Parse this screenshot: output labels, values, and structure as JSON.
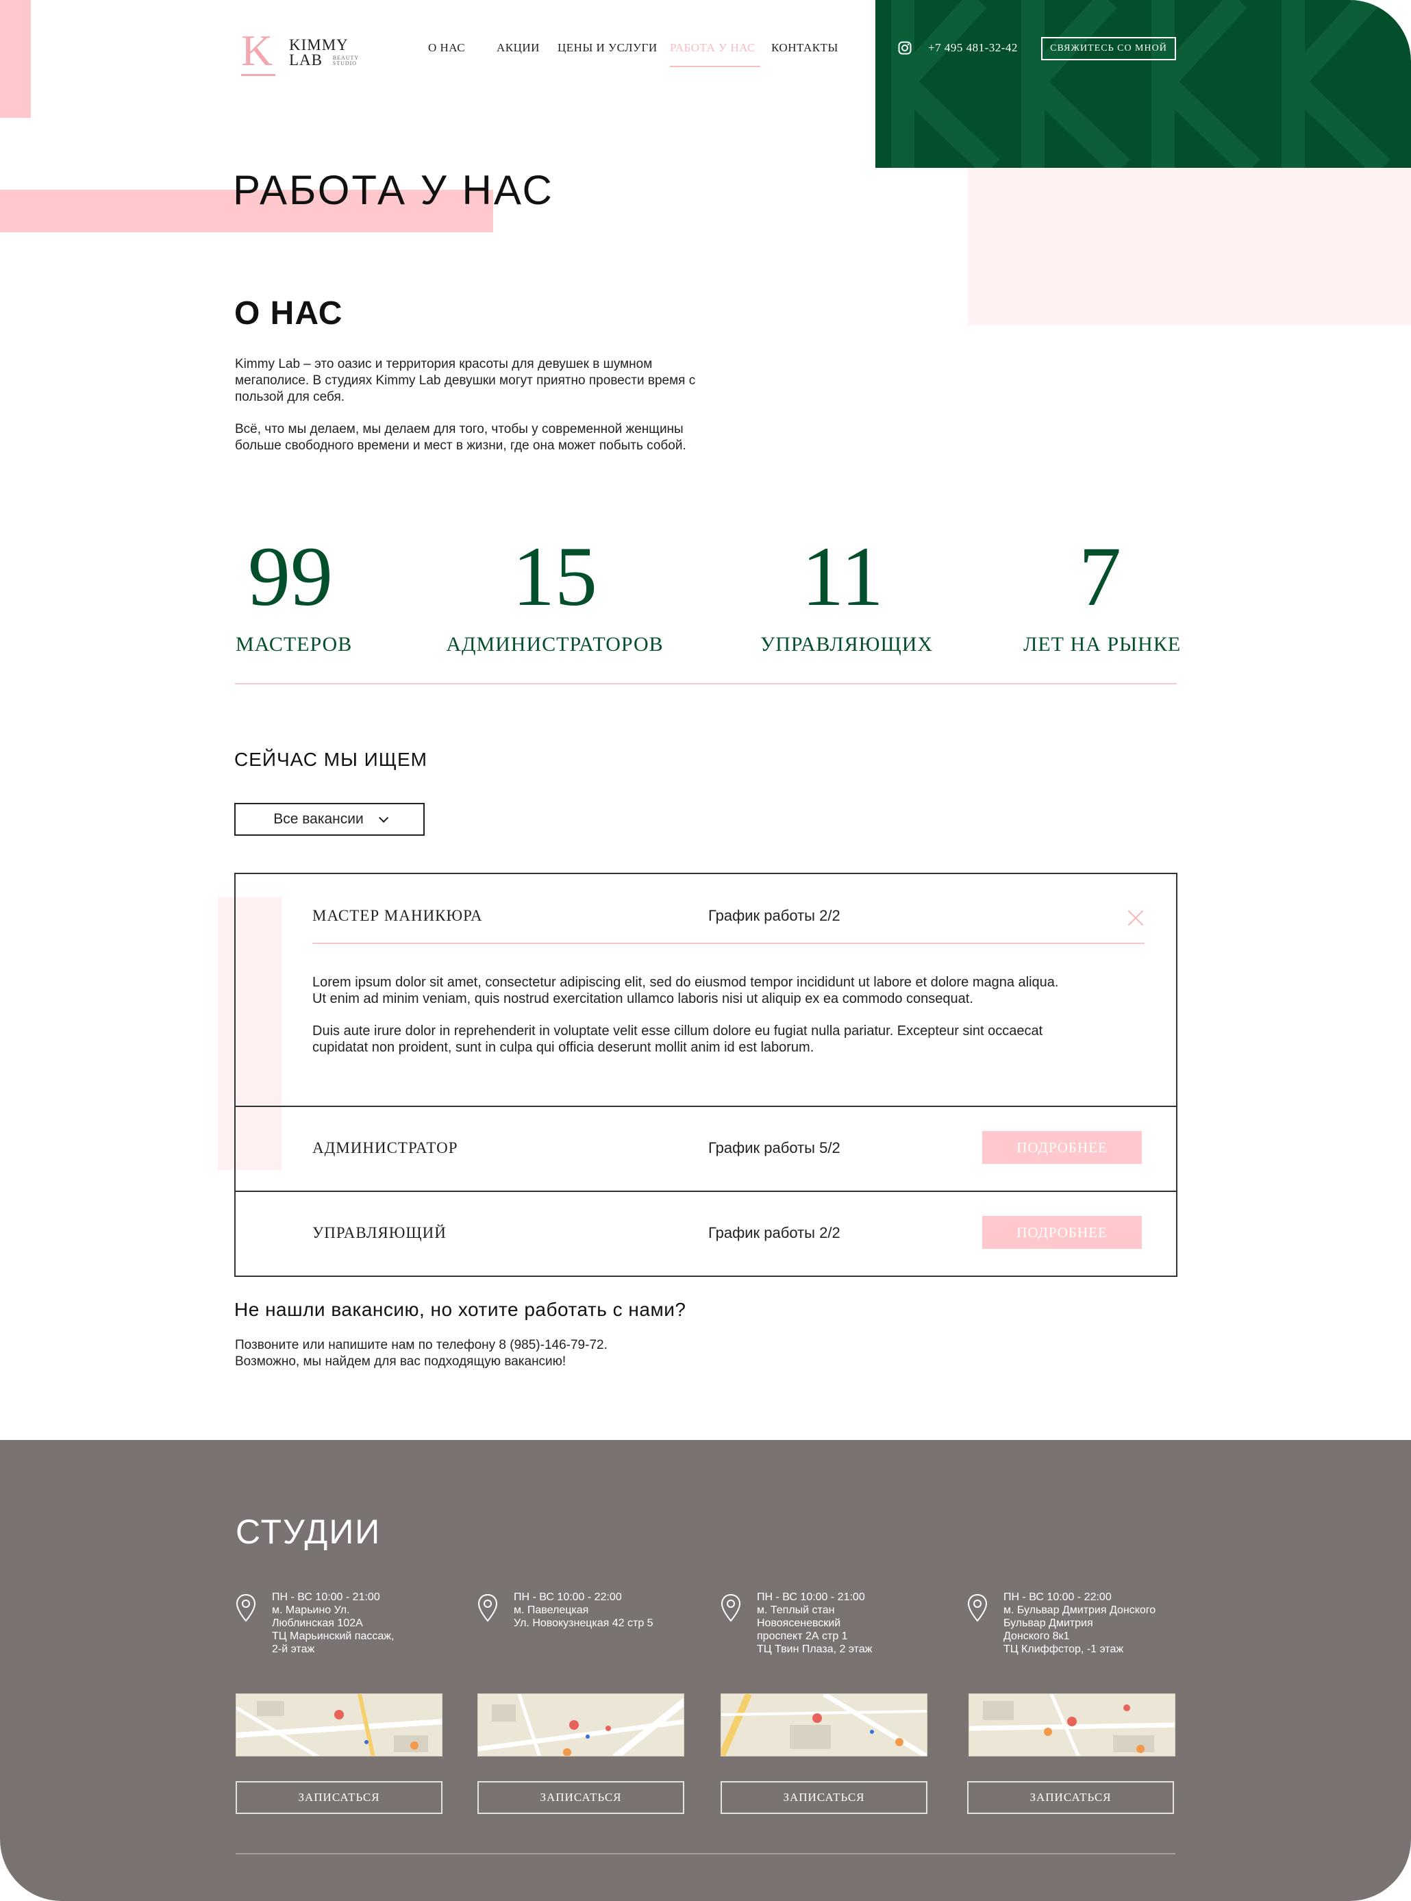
{
  "header": {
    "logo_letter": "K",
    "logo_line1": "KIMMY",
    "logo_line2": "LAB",
    "logo_sub1": "BEAUTY",
    "logo_sub2": "STUDIO",
    "nav": [
      {
        "label": "О НАС",
        "active": false
      },
      {
        "label": "АКЦИИ",
        "active": false
      },
      {
        "label": "ЦЕНЫ И УСЛУГИ",
        "active": false
      },
      {
        "label": "РАБОТА У НАС",
        "active": true
      },
      {
        "label": "КОНТАКТЫ",
        "active": false
      }
    ],
    "phone": "+7 495 481-32-42",
    "contact_button": "СВЯЖИТЕСЬ СО МНОЙ",
    "instagram_icon": "instagram-icon"
  },
  "page_title": "РАБОТА У НАС",
  "about": {
    "title": "О НАС",
    "p1_line1": "Kimmy Lab – это оазис и территория красоты для девушек в шумном",
    "p1_line2": "мегаполисе. В студиях Kimmy Lab  девушки могут приятно провести время с",
    "p1_line3": "пользой для себя.",
    "p2_line1": "Всё, что мы делаем, мы делаем для того, чтобы у современной женщины",
    "p2_line2": "больше свободного времени и мест в жизни, где она может побыть собой."
  },
  "stats": [
    {
      "number": "99",
      "label": "МАСТЕРОВ"
    },
    {
      "number": "15",
      "label": "АДМИНИСТРАТОРОВ"
    },
    {
      "number": "11",
      "label": "УПРАВЛЯЮЩИХ"
    },
    {
      "number": "7",
      "label": "ЛЕТ НА РЫНКЕ"
    }
  ],
  "vacancies": {
    "heading": "СЕЙЧАС МЫ ИЩЕМ",
    "filter_value": "Все вакансии",
    "items": [
      {
        "title": "МАСТЕР МАНИКЮРА",
        "schedule": "График работы 2/2",
        "expanded": true,
        "desc1_line1": "Lorem ipsum dolor sit amet, consectetur adipiscing elit, sed do eiusmod tempor incididunt ut labore et dolore magna aliqua.",
        "desc1_line2": "Ut enim ad minim veniam, quis nostrud exercitation ullamco laboris nisi ut aliquip ex ea commodo consequat.",
        "desc2_line1": "Duis aute irure dolor in reprehenderit in voluptate velit esse cillum dolore eu fugiat nulla pariatur. Excepteur sint occaecat",
        "desc2_line2": "cupidatat non proident, sunt in culpa qui officia deserunt mollit anim id est laborum."
      },
      {
        "title": "АДМИНИСТРАТОР",
        "schedule": "График работы 5/2",
        "button": "ПОДРОБНЕЕ"
      },
      {
        "title": "УПРАВЛЯЮЩИЙ",
        "schedule": "График работы 2/2",
        "button": "ПОДРОБНЕЕ"
      }
    ]
  },
  "not_found": {
    "title": "Не нашли вакансию, но хотите работать с нами?",
    "line1": "Позвоните или напишите нам по телефону 8 (985)-146-79-72.",
    "line2": "Возможно, мы найдем для вас подходящую вакансию!"
  },
  "footer": {
    "title": "СТУДИИ",
    "studios": [
      {
        "lines": [
          "ПН - ВС 10:00 - 21:00",
          "м. Марьино Ул.",
          "Люблинская 102А",
          "ТЦ Марьинский пассаж,",
          "2-й этаж"
        ],
        "button": "ЗАПИСАТЬСЯ"
      },
      {
        "lines": [
          "ПН - ВС 10:00 - 22:00",
          "м. Павелецкая",
          "Ул. Новокузнецкая 42 стр 5"
        ],
        "button": "ЗАПИСАТЬСЯ"
      },
      {
        "lines": [
          "ПН - ВС 10:00 - 21:00",
          "м. Теплый стан",
          "Новоясеневский",
          "проспект 2А стр 1",
          "ТЦ Твин Плаза, 2 этаж"
        ],
        "button": "ЗАПИСАТЬСЯ"
      },
      {
        "lines": [
          "ПН - ВС 10:00 - 22:00",
          "м. Бульвар Дмитрия Донского",
          "Бульвар Дмитрия",
          "Донского 8к1",
          "ТЦ Клиффстор, -1 этаж"
        ],
        "button": "ЗАПИСАТЬСЯ"
      }
    ]
  },
  "colors": {
    "brand_green": "#034f2c",
    "brand_pink": "#ffc8cc",
    "footer_bg": "#7b7371"
  }
}
